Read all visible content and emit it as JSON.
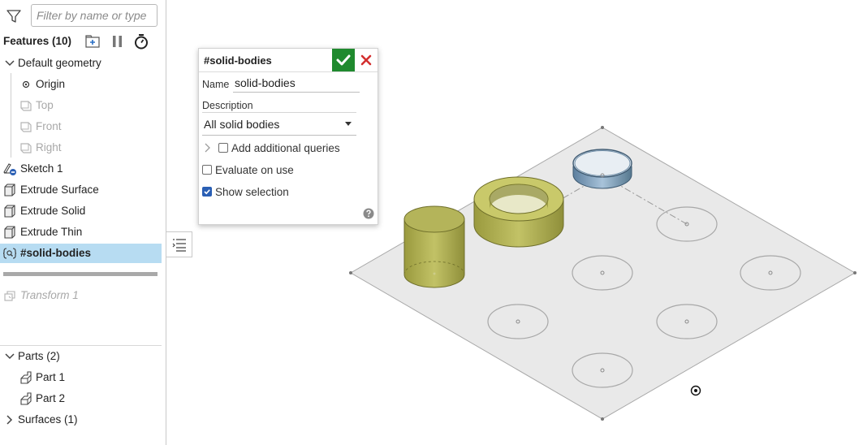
{
  "filter": {
    "placeholder": "Filter by name or type"
  },
  "features": {
    "header": "Features (10)",
    "default_geometry": "Default geometry",
    "origin": "Origin",
    "top": "Top",
    "front": "Front",
    "right": "Right",
    "sketch": "Sketch 1",
    "extrude_surface": "Extrude Surface",
    "extrude_solid": "Extrude Solid",
    "extrude_thin": "Extrude Thin",
    "selected_query": "#solid-bodies",
    "transform": "Transform 1"
  },
  "parts": {
    "header": "Parts (2)",
    "items": [
      "Part 1",
      "Part 2"
    ],
    "surfaces": "Surfaces (1)"
  },
  "dialog": {
    "title": "#solid-bodies",
    "name_label": "Name",
    "name_value": "solid-bodies",
    "description_label": "Description",
    "query_value": "All solid bodies",
    "add_queries_label": "Add additional queries",
    "evaluate_label": "Evaluate on use",
    "show_selection_label": "Show selection",
    "add_queries_checked": false,
    "evaluate_checked": false,
    "show_selection_checked": true
  },
  "colors": {
    "confirm": "#1f8a2e",
    "cancel": "#d32f2f",
    "selected_row": "#b7dcf2",
    "solid_body": "#c9c96a",
    "thin_body": "#7ea2c2",
    "plane": "#e9e9e9"
  },
  "icons": {
    "filter": "filter-icon",
    "add_folder": "add-folder-icon",
    "pause": "pause-icon",
    "stopwatch": "stopwatch-icon",
    "confirm": "checkmark-icon",
    "cancel": "close-icon",
    "help": "help-icon",
    "list_toggle": "list-toggle-icon"
  }
}
